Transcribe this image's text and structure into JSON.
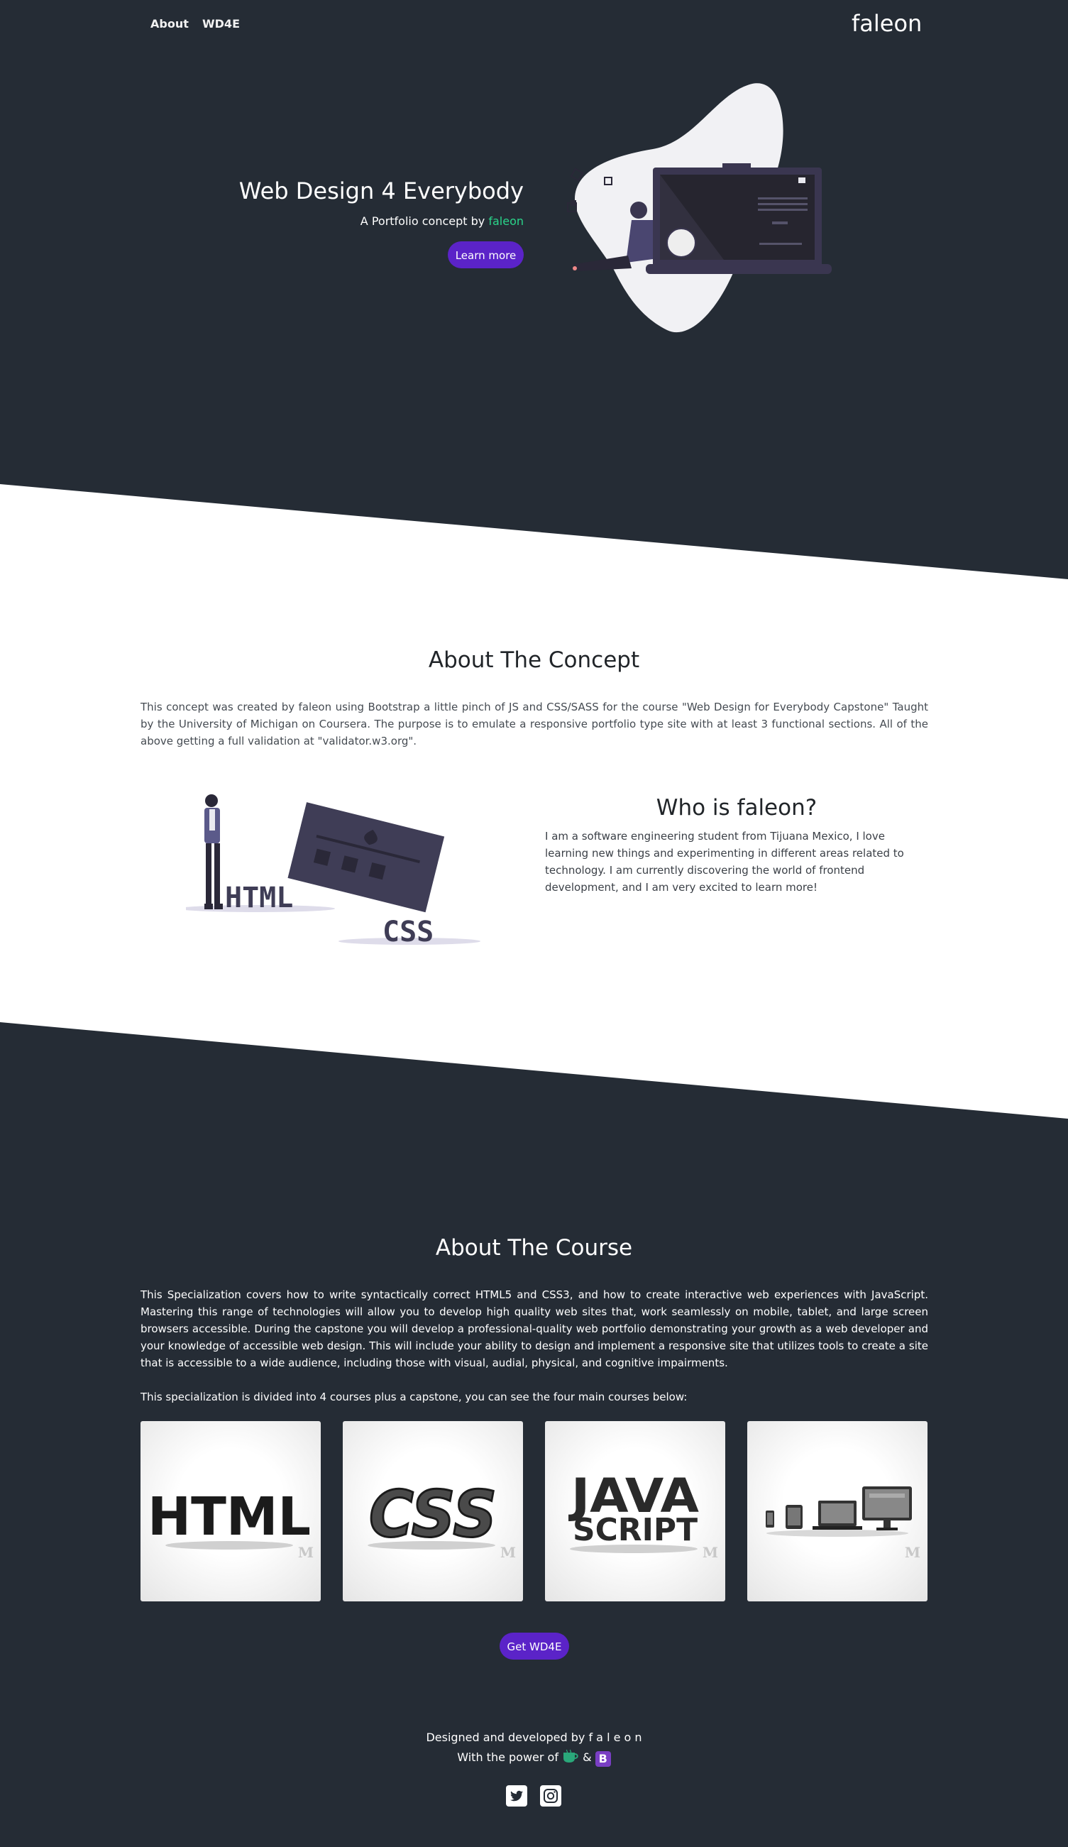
{
  "nav": {
    "about": "About",
    "wd4e": "WD4E",
    "brand": "faleon"
  },
  "hero": {
    "title": "Web Design 4 Everybody",
    "subtitle_prefix": "A Portfolio concept by",
    "subtitle_name": "faleon",
    "cta": "Learn more"
  },
  "concept": {
    "title": "About The Concept",
    "text": "This concept was created by faleon using Bootstrap a little pinch of JS and CSS/SASS for the course \"Web Design for Everybody Capstone\" Taught by the University of Michigan on Coursera. The purpose is to emulate a responsive portfolio type site with at least 3 functional sections. All of the above getting a full validation at \"validator.w3.org\".",
    "image_words": {
      "html": "HTML",
      "css": "CSS"
    }
  },
  "who": {
    "title": "Who is faleon?",
    "text": "I am a software engineering student from Tijuana Mexico, I love learning new things and experimenting in different areas related to technology. I am currently discovering the world of frontend development, and I am very excited to learn more!"
  },
  "course": {
    "title": "About The Course",
    "text1": "This Specialization covers how to write syntactically correct HTML5 and CSS3, and how to create interactive web experiences with JavaScript. Mastering this range of technologies will allow you to develop high quality web sites that, work seamlessly on mobile, tablet, and large screen browsers accessible. During the capstone you will develop a professional-quality web portfolio demonstrating your growth as a web developer and your knowledge of accessible web design. This will include your ability to design and implement a responsive site that utilizes tools to create a site that is accessible to a wide audience, including those with visual, audial, physical, and cognitive impairments.",
    "text2": "This specialization is divided into 4 courses plus a capstone, you can see the four main courses below:",
    "cards": [
      {
        "word": "HTML"
      },
      {
        "word": "CSS"
      },
      {
        "word_1": "JAVA",
        "word_2": "SCRIPT"
      },
      {
        "icon": "responsive-devices-icon"
      }
    ],
    "card_badge": "M",
    "cta": "Get WD4E"
  },
  "footer": {
    "line1": "Designed and developed by f a l e o n",
    "line2_prefix": "With the power of",
    "line2_amp": "&",
    "bootstrap_letter": "B",
    "icons": [
      "coffee-icon",
      "bootstrap-icon",
      "twitter-icon",
      "instagram-icon"
    ]
  },
  "colors": {
    "dark": "#252c35",
    "accent_purple": "#5b23c8",
    "accent_green": "#2ad48a"
  }
}
